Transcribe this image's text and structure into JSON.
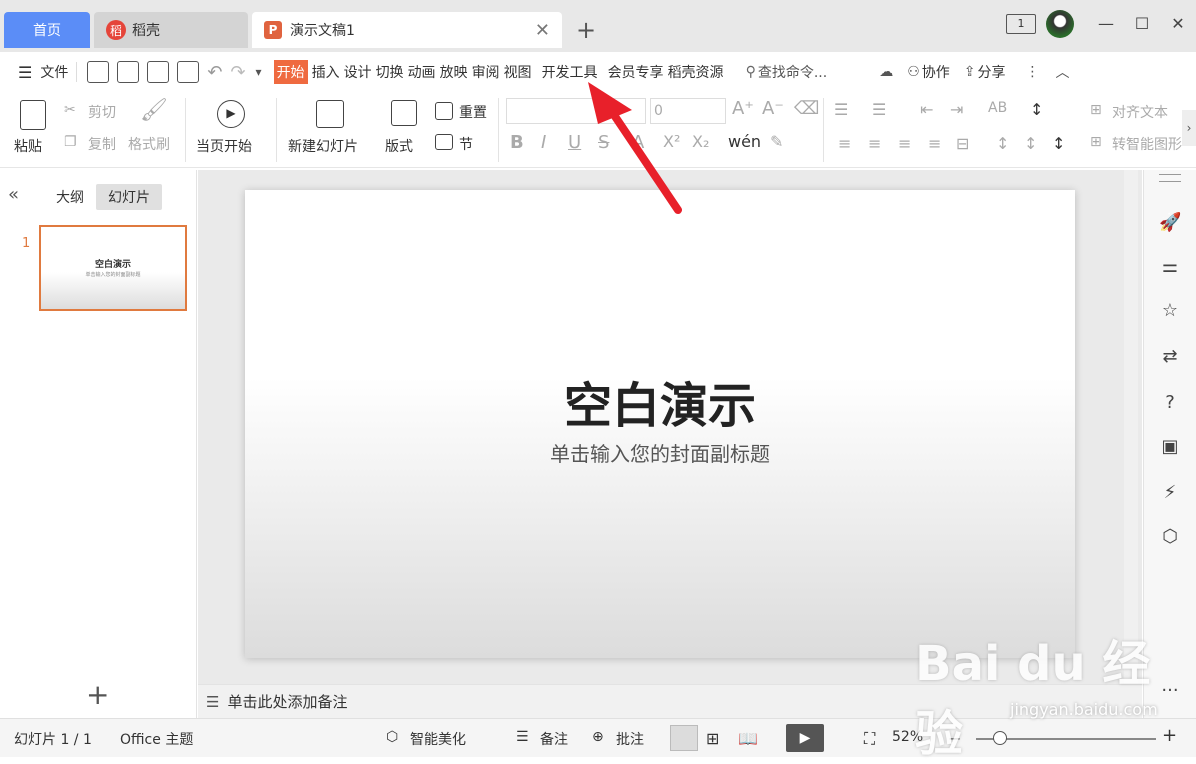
{
  "tabs": {
    "home": "首页",
    "daoke": "稻壳",
    "doc": "演示文稿1"
  },
  "menu": {
    "file": "文件",
    "items": [
      "开始",
      "插入",
      "设计",
      "切换",
      "动画",
      "放映",
      "审阅",
      "视图",
      "开发工具",
      "会员专享",
      "稻壳资源"
    ],
    "search": "查找命令...",
    "collab": "协作",
    "share": "分享"
  },
  "ribbon": {
    "paste": "粘贴",
    "cut": "剪切",
    "copy": "复制",
    "format_painter": "格式刷",
    "play_from_current": "当页开始",
    "new_slide": "新建幻灯片",
    "layout": "版式",
    "reset": "重置",
    "section": "节",
    "font_size": "0",
    "align_text": "对齐文本",
    "smart_graphic": "转智能图形"
  },
  "left_panel": {
    "outline_tab": "大纲",
    "slides_tab": "幻灯片",
    "slide_number": "1",
    "thumb_title": "空白演示",
    "thumb_sub": "单击输入您的封面副标题"
  },
  "slide": {
    "title": "空白演示",
    "subtitle": "单击输入您的封面副标题"
  },
  "notes": {
    "placeholder": "单击此处添加备注"
  },
  "status": {
    "slide_count": "幻灯片 1 / 1",
    "theme": "Office 主题",
    "beautify": "智能美化",
    "notes": "备注",
    "comment": "批注",
    "zoom": "52%"
  },
  "watermark": {
    "brand": "Bai du 经验",
    "url": "jingyan.baidu.com"
  },
  "colors": {
    "accent": "#ef6a40",
    "home_tab": "#5b8df7",
    "arrow": "#e8202a"
  }
}
